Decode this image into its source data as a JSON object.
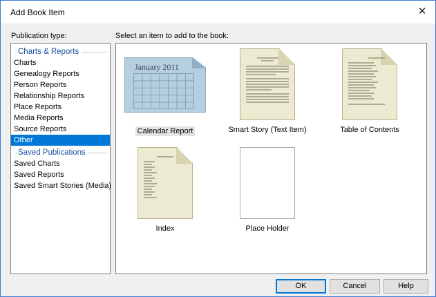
{
  "window": {
    "title": "Add Book Item"
  },
  "labels": {
    "publication_type": "Publication type:",
    "select_item": "Select an item to add to the book:"
  },
  "groups": [
    {
      "header": "Charts & Reports",
      "items": [
        "Charts",
        "Genealogy Reports",
        "Person Reports",
        "Relationship Reports",
        "Place Reports",
        "Media Reports",
        "Source Reports",
        "Other"
      ]
    },
    {
      "header": "Saved Publications",
      "items": [
        "Saved Charts",
        "Saved Reports",
        "Saved Smart Stories (Media)"
      ]
    }
  ],
  "selected_item": "Other",
  "tiles": [
    {
      "label": "Calendar Report",
      "thumb_text": "January 2011"
    },
    {
      "label": "Smart Story (Text Item)"
    },
    {
      "label": "Table of Contents"
    },
    {
      "label": "Index"
    },
    {
      "label": "Place Holder"
    }
  ],
  "buttons": {
    "ok": "OK",
    "cancel": "Cancel",
    "help": "Help"
  },
  "icons": {
    "close": "close-icon"
  }
}
